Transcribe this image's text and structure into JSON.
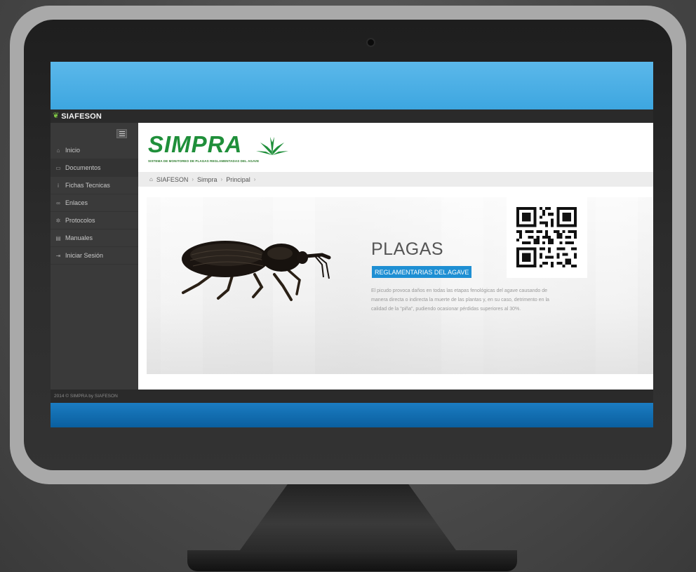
{
  "app": {
    "brand": "SIAFESON"
  },
  "sidebar": {
    "items": [
      {
        "label": "Inicio",
        "icon": "home-icon"
      },
      {
        "label": "Documentos",
        "icon": "folder-icon"
      },
      {
        "label": "Fichas Tecnicas",
        "icon": "info-icon"
      },
      {
        "label": "Enlaces",
        "icon": "link-icon"
      },
      {
        "label": "Protocolos",
        "icon": "gear-icon"
      },
      {
        "label": "Manuales",
        "icon": "book-icon"
      },
      {
        "label": "Iniciar Sesión",
        "icon": "sign-in-icon"
      }
    ]
  },
  "header": {
    "logo_text": "SIMPRA",
    "logo_subtitle": "SISTEMA DE MONITOREO DE PLAGAS REGLAMENTADAS DEL AGAVE"
  },
  "breadcrumb": {
    "items": [
      "SIAFESON",
      "Simpra",
      "Principal"
    ]
  },
  "banner": {
    "title": "PLAGAS",
    "badge": "REGLAMENTARIAS DEL AGAVE",
    "description": "El picudo provoca daños en todas las etapas fenológicas del agave causando de manera directa o indirecta la muerte de las plantas y, en su caso, detrimento en la calidad de la \"piña\", pudiendo ocasionar pérdidas superiores al 30%."
  },
  "footer": {
    "text": "2014 © SIMPRA by SIAFESON"
  },
  "colors": {
    "accent_blue": "#1e8fd3",
    "brand_green": "#1f8f3a",
    "sidebar_bg": "#3a3a3a"
  }
}
